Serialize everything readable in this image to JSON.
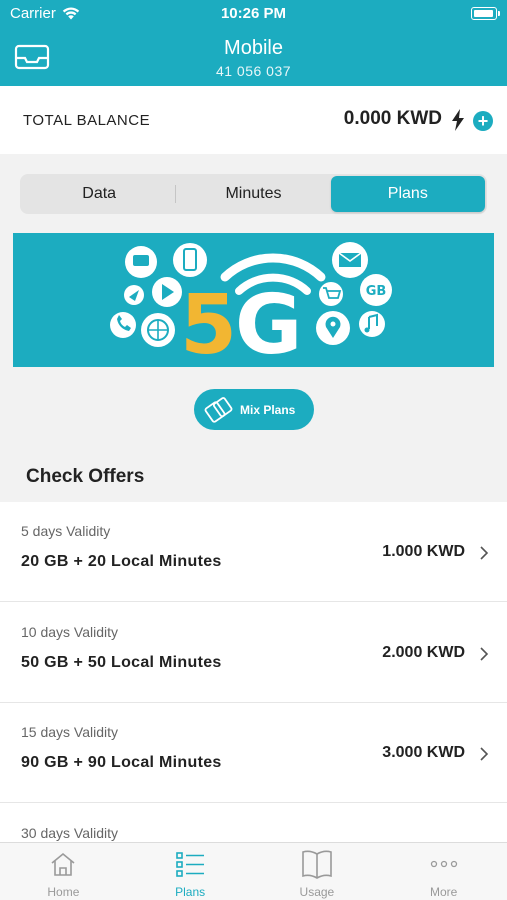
{
  "status_bar": {
    "carrier": "Carrier",
    "time": "10:26 PM"
  },
  "header": {
    "title": "Mobile",
    "subtitle": "41 056 037"
  },
  "balance": {
    "label": "TOTAL BALANCE",
    "amount": "0.000 KWD"
  },
  "segments": [
    {
      "label": "Data",
      "active": false
    },
    {
      "label": "Minutes",
      "active": false
    },
    {
      "label": "Plans",
      "active": true
    }
  ],
  "banner": {
    "text": "5G",
    "badge": "GB"
  },
  "mix_button": {
    "label": "Mix Plans"
  },
  "offers": {
    "title": "Check Offers",
    "items": [
      {
        "validity": "5 days Validity",
        "description": "20 GB  + 20 Local Minutes",
        "price": "1.000 KWD"
      },
      {
        "validity": "10 days Validity",
        "description": "50 GB  + 50 Local Minutes",
        "price": "2.000 KWD"
      },
      {
        "validity": "15 days Validity",
        "description": "90 GB  + 90 Local Minutes",
        "price": "3.000 KWD"
      },
      {
        "validity": "30 days Validity",
        "description": "",
        "price": ""
      }
    ]
  },
  "tabbar": [
    {
      "label": "Home",
      "icon": "home-icon",
      "active": false
    },
    {
      "label": "Plans",
      "icon": "list-icon",
      "active": true
    },
    {
      "label": "Usage",
      "icon": "book-icon",
      "active": false
    },
    {
      "label": "More",
      "icon": "more-dots-icon",
      "active": false
    }
  ],
  "colors": {
    "accent": "#1cacc0",
    "gold": "#f2b632"
  }
}
